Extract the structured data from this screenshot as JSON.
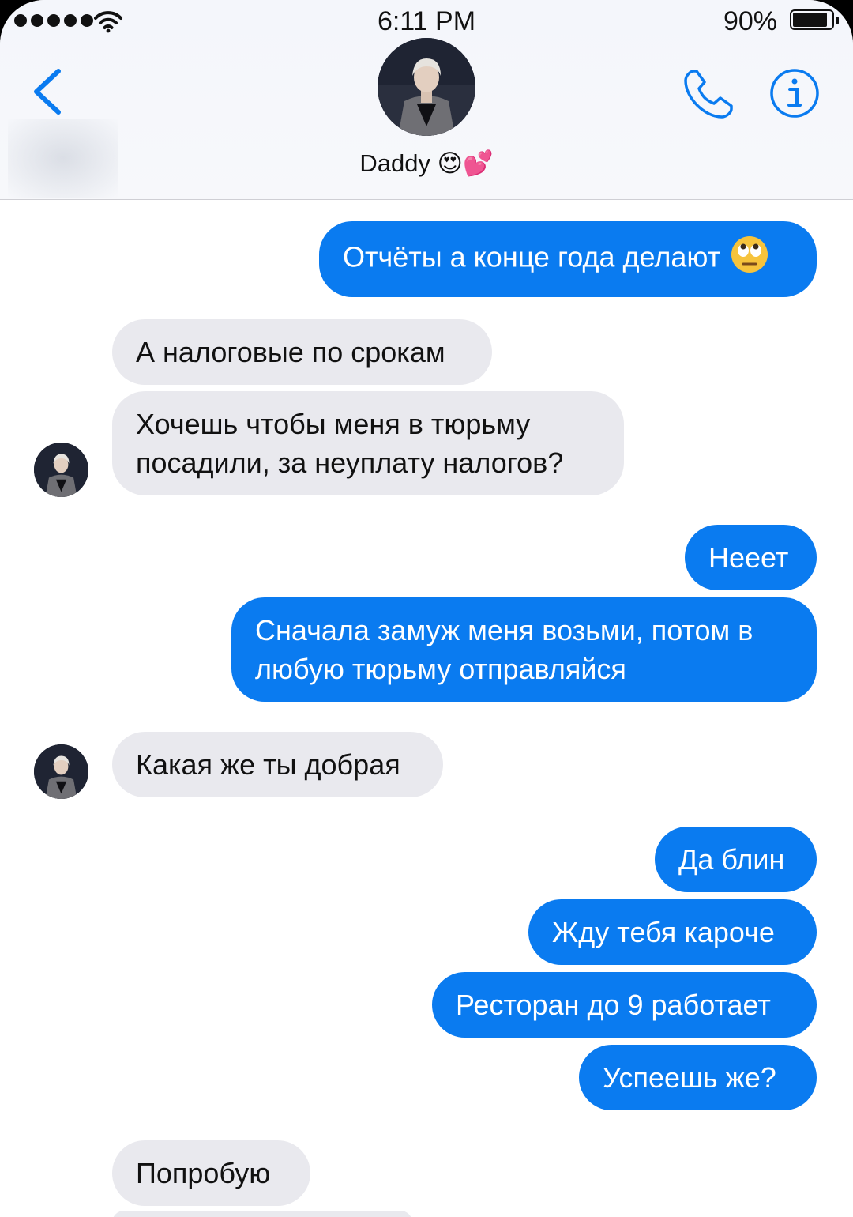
{
  "status_bar": {
    "time": "6:11 PM",
    "battery": "90%",
    "battery_level": 0.9
  },
  "header": {
    "contact_name": "Daddy",
    "name_emoji": "😍💕"
  },
  "icons": {
    "back": "chevron-left-icon",
    "call": "phone-icon",
    "info": "info-icon",
    "signal": "cellular-signal-icon",
    "wifi": "wifi-icon",
    "battery": "battery-icon"
  },
  "colors": {
    "outgoing": "#0a7bf0",
    "incoming": "#e9e9ee",
    "accent": "#0a7bf0"
  },
  "messages": [
    {
      "dir": "out",
      "text": "Отчёты а конце года делают",
      "emoji": "🙄"
    },
    {
      "dir": "in",
      "text": "А налоговые по срокам"
    },
    {
      "dir": "in",
      "text": "Хочешь чтобы меня в тюрьму",
      "text2": "посадили, за неуплату налогов?"
    },
    {
      "dir": "out",
      "text": "Нееет"
    },
    {
      "dir": "out",
      "text": "Сначала замуж меня возьми, потом в",
      "text2": "любую тюрьму отправляйся"
    },
    {
      "dir": "in",
      "text": "Какая же ты добрая"
    },
    {
      "dir": "out",
      "text": "Да блин"
    },
    {
      "dir": "out",
      "text": "Жду тебя кароче"
    },
    {
      "dir": "out",
      "text": "Ресторан до 9 работает"
    },
    {
      "dir": "out",
      "text": "Успеешь же?"
    },
    {
      "dir": "in",
      "text": "Попробую"
    }
  ]
}
